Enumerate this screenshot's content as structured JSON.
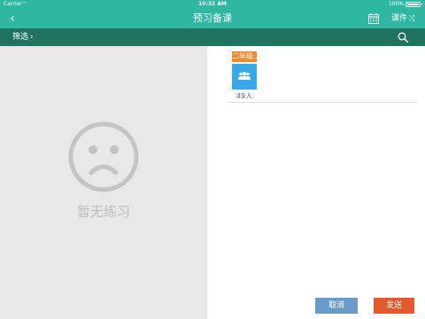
{
  "status_bar": {
    "carrier": "Carrier",
    "time": "10:32 AM",
    "battery": "100%"
  },
  "nav": {
    "title": "预习备课",
    "kejian_label": "课件"
  },
  "filter_bar": {
    "filter_label": "筛选"
  },
  "empty_state": {
    "text": "暂无练习"
  },
  "class_card": {
    "grade": "二年级...",
    "count": "49人"
  },
  "actions": {
    "cancel": "取消",
    "send": "发送"
  },
  "colors": {
    "header": "#2fb7a2",
    "filter_bar": "#1f7360",
    "grade_tag": "#f08a2c",
    "class_box": "#35a9ea",
    "cancel": "#6b9bc7",
    "send": "#e25a2c"
  }
}
